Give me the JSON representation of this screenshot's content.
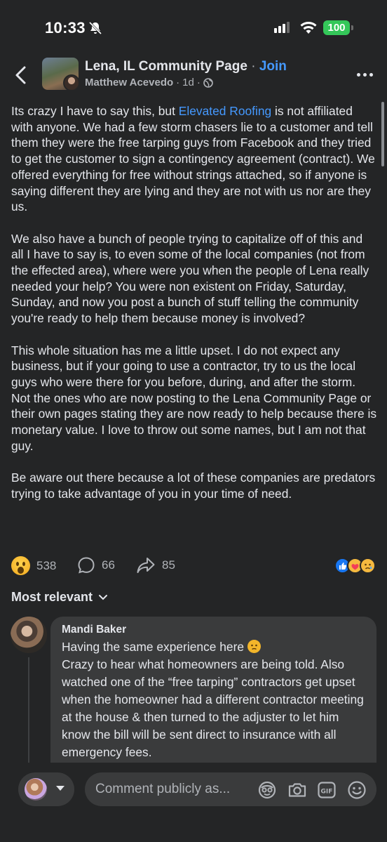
{
  "status_bar": {
    "time": "10:33",
    "battery": "100"
  },
  "header": {
    "group_name": "Lena, IL Community Page",
    "separator": "·",
    "join_label": "Join",
    "author": "Matthew Acevedo",
    "meta_sep": "·",
    "age": "1d",
    "meta_sep2": "·"
  },
  "post": {
    "p1_before": "Its crazy I have to say this, but ",
    "p1_link": "Elevated Roofing",
    "p1_after": " is not affiliated with anyone. We had a few storm chasers lie to a customer and tell them they were the free tarping guys from Facebook and they tried to get the customer to sign a contingency agreement (contract). We offered everything for free without strings attached, so if anyone is saying different they are lying and they are not with us nor are they us.",
    "p2": "We also have a bunch of people trying to capitalize off of this and all I have to say is,  to even some of the local companies (not from the effected area), where were you when the people of Lena really needed your help? You were non existent on Friday, Saturday, Sunday, and now you post a bunch of stuff telling the community you're ready to help them because money is involved?",
    "p3": "This whole situation has me a little upset. I do not expect any business, but if your going to use a contractor, try to us the local guys who were there for you before, during, and after the storm. Not the ones who are now posting to the Lena Community Page or their own pages stating they are now ready to help because there is monetary value. I love to throw out some names, but I am not that guy.",
    "p4": "Be aware out there because a lot of these companies are predators trying to take advantage of you in your time of need."
  },
  "stats": {
    "reactions": "538",
    "comments": "66",
    "shares": "85"
  },
  "sort_label": "Most relevant",
  "comment": {
    "name": "Mandi Baker",
    "line1": "Having the same experience here ",
    "body": "Crazy to hear what homeowners are being told. Also watched one of the “free tarping” contractors get upset when the homeowner had a different contractor meeting at the house & then turned to the adjuster to let him know the bill will be sent direct to insurance with all emergency fees."
  },
  "composer": {
    "placeholder": "Comment publicly as..."
  },
  "colors": {
    "background": "#242526",
    "bubble": "#3a3b3c",
    "link": "#4599ff",
    "battery": "#34c759"
  }
}
